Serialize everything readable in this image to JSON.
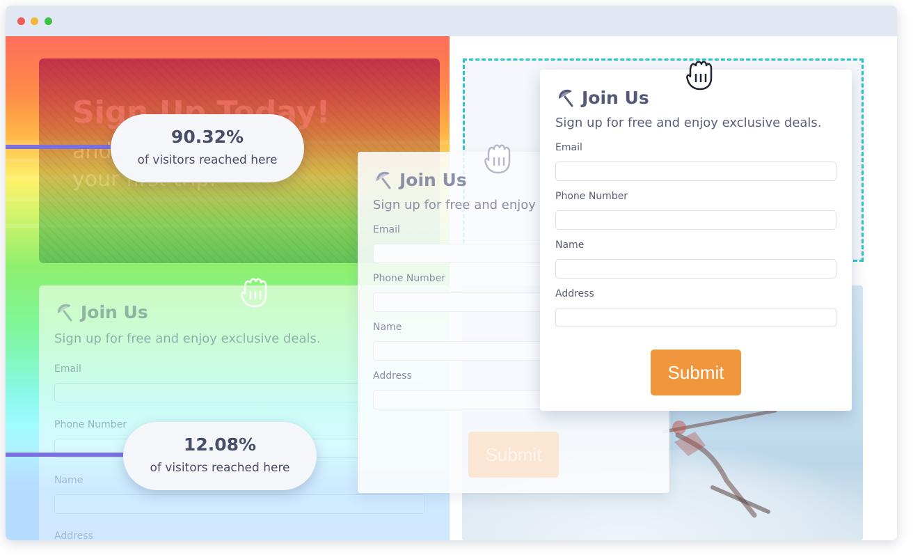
{
  "hero": {
    "title": "Sign Up Today!",
    "subtitle_line1": "and",
    "subtitle_line2": "your first trip."
  },
  "reach_markers": [
    {
      "percent": "90.32%",
      "caption": "of visitors reached here"
    },
    {
      "percent": "12.08%",
      "caption": "of visitors reached here"
    }
  ],
  "signup_form": {
    "title": "Join Us",
    "subtitle": "Sign up for free and enjoy exclusive deals.",
    "fields": [
      "Email",
      "Phone Number",
      "Name",
      "Address"
    ],
    "submit_label": "Submit"
  },
  "ghost_form": {
    "title": "Join Us",
    "subtitle": "Sign up for free and enjoy",
    "fields": [
      "Email",
      "Phone Number",
      "Name",
      "Address"
    ],
    "submit_label": "Submit"
  },
  "colors": {
    "accent": "#f0963d",
    "drop_zone": "#27c6cd",
    "reach_line": "#7b70e0"
  },
  "icons": [
    "umbrella-icon",
    "grab-hand-icon"
  ]
}
